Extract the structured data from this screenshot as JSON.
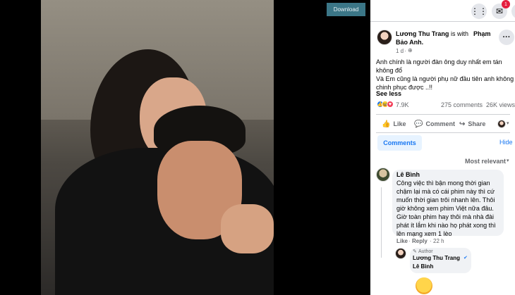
{
  "viewer": {
    "download_label": "Download"
  },
  "topbar": {
    "notification_count": "1"
  },
  "post": {
    "author": "Lương Thu Trang",
    "with_text": "is with",
    "tagged_line1": "Phạm",
    "tagged_line2": "Bảo Anh.",
    "time": "1 d",
    "privacy_sep": "·",
    "text_line1": "Anh chính là người đàn ông duy nhất em tán",
    "text_line2": "không đổ",
    "text_line3": "Và Em cũng là người phụ nữ đầu tiên anh không",
    "text_line4": "chinh phục được ..!!",
    "see_less": "See less",
    "reaction_count": "7.9K",
    "comments_count": "275 comments",
    "views_count": "26K views"
  },
  "actions": {
    "like": "Like",
    "comment": "Comment",
    "share": "Share"
  },
  "comments_section": {
    "tab_label": "Comments",
    "hide_label": "Hide",
    "sort_label": "Most relevant"
  },
  "comment1": {
    "author": "Lê Bình",
    "lines": [
      "Công việc thì bận mong thời gian",
      "chậm lại mà có cái phim này thì cứ",
      "muốn thời gian trôi nhanh lên. Thôi",
      "giờ không xem phim Việt nữa đâu.",
      "Giờ toàn phim hay thôi mà nhà đài",
      "phát ít lắm khi nào họ phát xong thì",
      "lên mạng xem 1 lèo"
    ],
    "like": "Like",
    "reply": "Reply",
    "time": "22 h"
  },
  "reply1": {
    "badge": "Author",
    "author": "Lương Thu Trang",
    "mention": "Lê Bình"
  },
  "colors": {
    "accent": "#1877f2",
    "download_bg": "#3b7687",
    "notification": "#e41e3f"
  }
}
